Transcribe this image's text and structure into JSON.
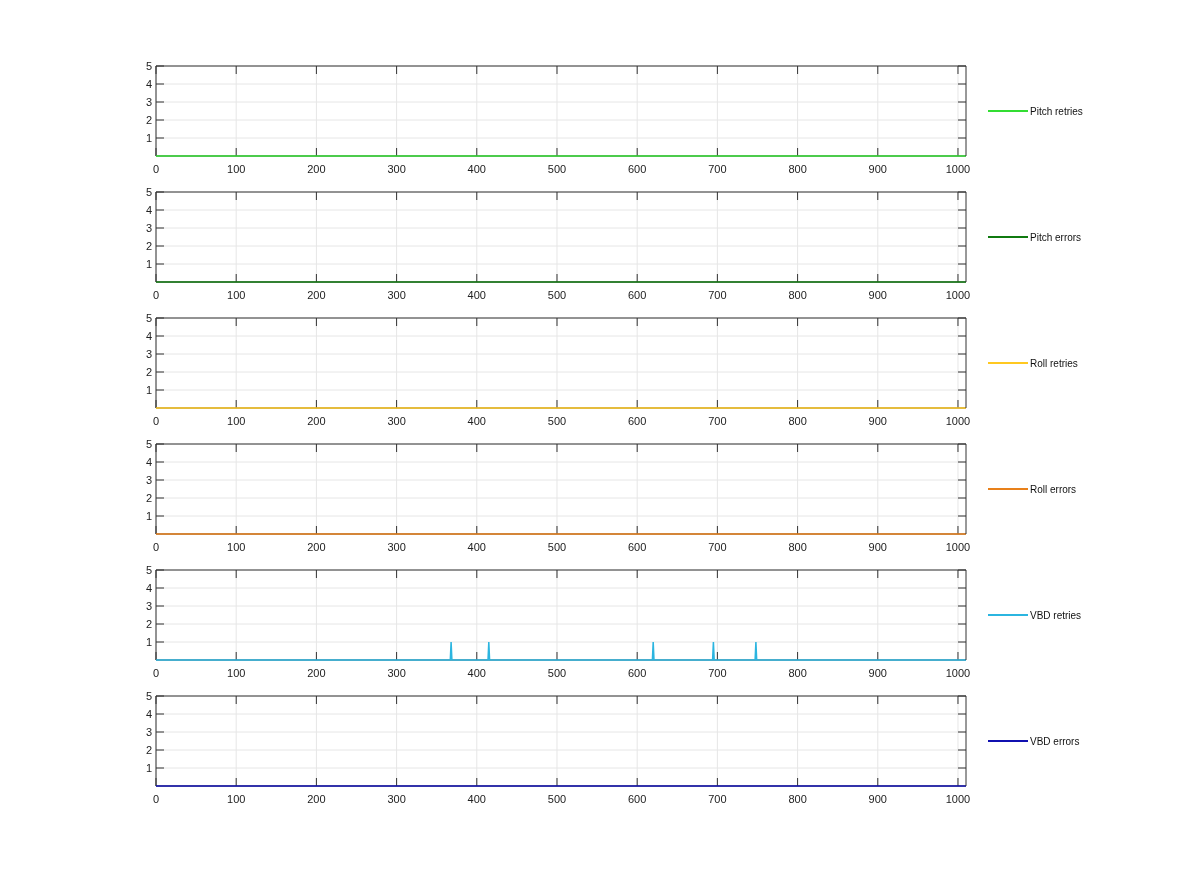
{
  "charts": [
    {
      "chart_data": {
        "type": "line",
        "grid": true,
        "x": [
          0,
          1010
        ],
        "xlim": [
          0,
          1010
        ],
        "ylim": [
          0,
          5
        ],
        "xticks": [
          0,
          100,
          200,
          300,
          400,
          500,
          600,
          700,
          800,
          900,
          1000
        ],
        "yticks": [
          1,
          2,
          3,
          4,
          5
        ],
        "series": [
          {
            "name": "Pitch retries",
            "color": "#33dd33",
            "values": [
              0,
              0
            ]
          }
        ]
      }
    },
    {
      "chart_data": {
        "type": "line",
        "grid": true,
        "x": [
          0,
          1010
        ],
        "xlim": [
          0,
          1010
        ],
        "ylim": [
          0,
          5
        ],
        "xticks": [
          0,
          100,
          200,
          300,
          400,
          500,
          600,
          700,
          800,
          900,
          1000
        ],
        "yticks": [
          1,
          2,
          3,
          4,
          5
        ],
        "series": [
          {
            "name": "Pitch errors",
            "color": "#107a10",
            "values": [
              0,
              0
            ]
          }
        ]
      }
    },
    {
      "chart_data": {
        "type": "line",
        "grid": true,
        "x": [
          0,
          1010
        ],
        "xlim": [
          0,
          1010
        ],
        "ylim": [
          0,
          5
        ],
        "xticks": [
          0,
          100,
          200,
          300,
          400,
          500,
          600,
          700,
          800,
          900,
          1000
        ],
        "yticks": [
          1,
          2,
          3,
          4,
          5
        ],
        "series": [
          {
            "name": "Roll retries",
            "color": "#ffc820",
            "values": [
              0,
              0
            ]
          }
        ]
      }
    },
    {
      "chart_data": {
        "type": "line",
        "grid": true,
        "x": [
          0,
          1010
        ],
        "xlim": [
          0,
          1010
        ],
        "ylim": [
          0,
          5
        ],
        "xticks": [
          0,
          100,
          200,
          300,
          400,
          500,
          600,
          700,
          800,
          900,
          1000
        ],
        "yticks": [
          1,
          2,
          3,
          4,
          5
        ],
        "series": [
          {
            "name": "Roll errors",
            "color": "#e8801a",
            "values": [
              0,
              0
            ]
          }
        ]
      }
    },
    {
      "chart_data": {
        "type": "line",
        "grid": true,
        "x": [
          0,
          367,
          368,
          369,
          414,
          415,
          416,
          619,
          620,
          621,
          694,
          695,
          696,
          747,
          748,
          749,
          1010
        ],
        "xlim": [
          0,
          1010
        ],
        "ylim": [
          0,
          5
        ],
        "xticks": [
          0,
          100,
          200,
          300,
          400,
          500,
          600,
          700,
          800,
          900,
          1000
        ],
        "yticks": [
          1,
          2,
          3,
          4,
          5
        ],
        "series": [
          {
            "name": "VBD retries",
            "color": "#2bb5e0",
            "values": [
              0,
              0,
              1,
              0,
              0,
              1,
              0,
              0,
              1,
              0,
              0,
              1,
              0,
              0,
              1,
              0,
              0
            ]
          }
        ]
      }
    },
    {
      "chart_data": {
        "type": "line",
        "grid": true,
        "x": [
          0,
          1010
        ],
        "xlim": [
          0,
          1010
        ],
        "ylim": [
          0,
          5
        ],
        "xticks": [
          0,
          100,
          200,
          300,
          400,
          500,
          600,
          700,
          800,
          900,
          1000
        ],
        "yticks": [
          1,
          2,
          3,
          4,
          5
        ],
        "series": [
          {
            "name": "VBD errors",
            "color": "#1010b0",
            "values": [
              0,
              0
            ]
          }
        ]
      }
    }
  ]
}
